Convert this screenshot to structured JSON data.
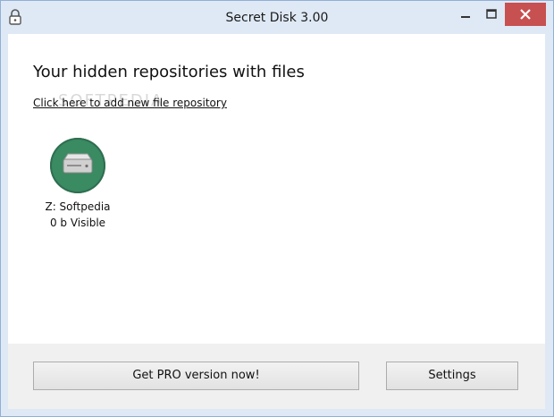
{
  "window": {
    "title": "Secret Disk 3.00"
  },
  "main": {
    "heading": "Your hidden repositories with files",
    "add_link": "Click here to add new file repository",
    "watermark": "SOFTPEDIA",
    "repositories": [
      {
        "name": "Z: Softpedia",
        "status": "0 b Visible",
        "icon": "hard-drive-icon"
      }
    ]
  },
  "footer": {
    "pro_label": "Get PRO version now!",
    "settings_label": "Settings"
  },
  "colors": {
    "disk_green": "#3a8a62",
    "close_red": "#c75050",
    "frame": "#dfe9f5"
  }
}
